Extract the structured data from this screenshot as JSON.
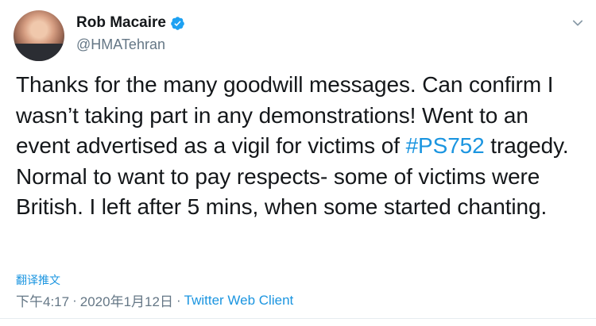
{
  "author": {
    "display_name": "Rob Macaire",
    "handle": "@HMATehran",
    "verified": true
  },
  "tweet": {
    "text_before_hashtag": "Thanks for the many goodwill messages. Can confirm I wasn’t taking part in any demonstrations! Went to an event advertised as a vigil for victims of ",
    "hashtag": "#PS752",
    "text_after_hashtag": " tragedy. Normal to want to pay respects- some of victims were British. I left after 5 mins, when some started chanting."
  },
  "translate_label": "翻译推文",
  "meta": {
    "time": "下午4:17",
    "separator": "·",
    "date": "2020年1月12日",
    "source": "Twitter Web Client"
  },
  "colors": {
    "link": "#1b95e0",
    "secondary": "#657786",
    "primary_text": "#14171a",
    "verified_badge": "#1da1f2"
  },
  "icons": {
    "verified": "verified-badge-icon",
    "more": "chevron-down-icon",
    "avatar": "profile-photo"
  }
}
